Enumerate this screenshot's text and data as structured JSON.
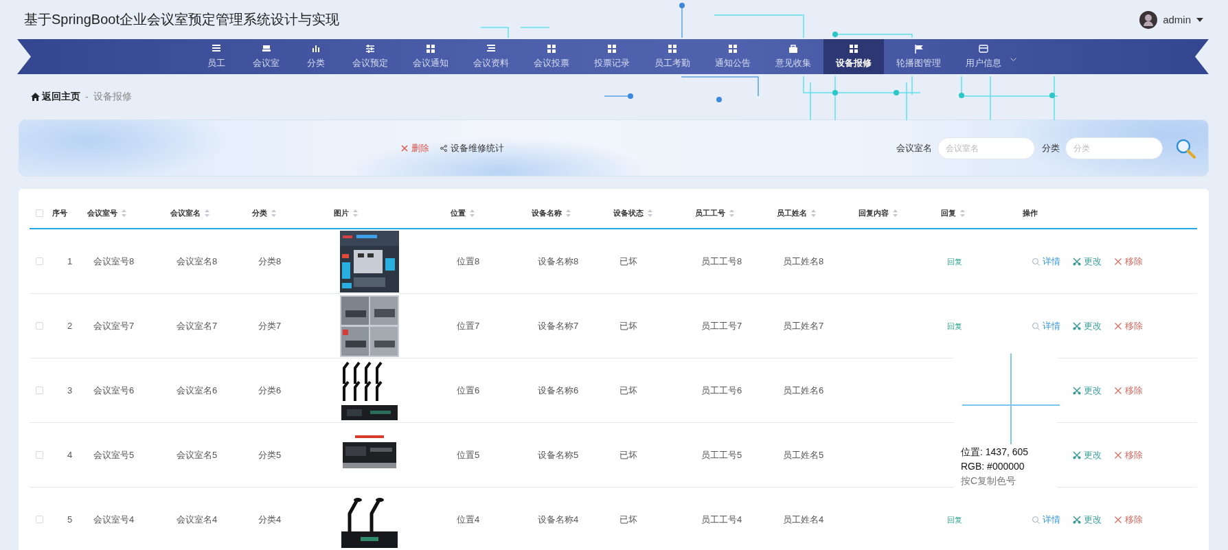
{
  "header": {
    "title": "基于SpringBoot企业会议室预定管理系统设计与实现",
    "user": "admin"
  },
  "nav": [
    {
      "label": "员工",
      "selected": false
    },
    {
      "label": "会议室",
      "selected": false
    },
    {
      "label": "分类",
      "selected": false
    },
    {
      "label": "会议预定",
      "selected": false
    },
    {
      "label": "会议通知",
      "selected": false
    },
    {
      "label": "会议资料",
      "selected": false
    },
    {
      "label": "会议投票",
      "selected": false
    },
    {
      "label": "投票记录",
      "selected": false
    },
    {
      "label": "员工考勤",
      "selected": false
    },
    {
      "label": "通知公告",
      "selected": false
    },
    {
      "label": "意见收集",
      "selected": false
    },
    {
      "label": "设备报修",
      "selected": true
    },
    {
      "label": "轮播图管理",
      "selected": false
    },
    {
      "label": "用户信息",
      "selected": false,
      "has_menu": true
    }
  ],
  "breadcrumb": {
    "home": "返回主页",
    "separator": "-",
    "current": "设备报修"
  },
  "toolbar": {
    "actions": [
      {
        "label": "删除",
        "kind": "delete"
      },
      {
        "label": "设备维修统计",
        "kind": "stats"
      }
    ],
    "filters": [
      {
        "label": "会议室名",
        "placeholder": "会议室名"
      },
      {
        "label": "分类",
        "placeholder": "分类"
      }
    ]
  },
  "table": {
    "select_all": {
      "checked": false
    },
    "columns": [
      {
        "label": "序号",
        "sortable": false
      },
      {
        "label": "会议室号",
        "sortable": true
      },
      {
        "label": "会议室名",
        "sortable": true
      },
      {
        "label": "分类",
        "sortable": true
      },
      {
        "label": "图片",
        "sortable": true
      },
      {
        "label": "位置",
        "sortable": true
      },
      {
        "label": "设备名称",
        "sortable": true
      },
      {
        "label": "设备状态",
        "sortable": true
      },
      {
        "label": "员工工号",
        "sortable": true
      },
      {
        "label": "员工姓名",
        "sortable": true
      },
      {
        "label": "回复内容",
        "sortable": true
      },
      {
        "label": "回复",
        "sortable": true
      },
      {
        "label": "操作",
        "sortable": false
      }
    ],
    "rows": [
      {
        "checked": false,
        "index": "1",
        "room_no": "会议室号8",
        "room_name": "会议室名8",
        "category": "分类8",
        "image": {
          "kind": "picture"
        },
        "location": "位置8",
        "device": "设备名称8",
        "status": "已坏",
        "emp_no": "员工工号8",
        "emp_name": "员工姓名8",
        "reply": "回复",
        "actions": [
          {
            "label": "详情",
            "kind": "detail"
          },
          {
            "label": "更改",
            "kind": "edit"
          },
          {
            "label": "移除",
            "kind": "delete"
          }
        ]
      },
      {
        "checked": false,
        "index": "2",
        "room_no": "会议室号7",
        "room_name": "会议室名7",
        "category": "分类7",
        "image": {
          "kind": "picture"
        },
        "location": "位置7",
        "device": "设备名称7",
        "status": "已坏",
        "emp_no": "员工工号7",
        "emp_name": "员工姓名7",
        "reply": "回复",
        "actions": [
          {
            "label": "详情",
            "kind": "detail"
          },
          {
            "label": "更改",
            "kind": "edit"
          },
          {
            "label": "移除",
            "kind": "delete"
          }
        ]
      },
      {
        "checked": false,
        "index": "3",
        "room_no": "会议室号6",
        "room_name": "会议室名6",
        "category": "分类6",
        "image": {
          "kind": "picture"
        },
        "location": "位置6",
        "device": "设备名称6",
        "status": "已坏",
        "emp_no": "员工工号6",
        "emp_name": "员工姓名6",
        "actions": [
          {
            "label": "更改",
            "kind": "edit"
          },
          {
            "label": "移除",
            "kind": "delete"
          }
        ]
      },
      {
        "checked": false,
        "index": "4",
        "room_no": "会议室号5",
        "room_name": "会议室名5",
        "category": "分类5",
        "image": {
          "kind": "picture"
        },
        "location": "位置5",
        "device": "设备名称5",
        "status": "已坏",
        "emp_no": "员工工号5",
        "emp_name": "员工姓名5",
        "actions": [
          {
            "label": "更改",
            "kind": "edit"
          },
          {
            "label": "移除",
            "kind": "delete"
          }
        ]
      },
      {
        "checked": false,
        "index": "5",
        "room_no": "会议室号4",
        "room_name": "会议室名4",
        "category": "分类4",
        "image": {
          "kind": "picture"
        },
        "location": "位置4",
        "device": "设备名称4",
        "status": "已坏",
        "emp_no": "员工工号4",
        "emp_name": "员工姓名4",
        "reply": "回复",
        "actions": [
          {
            "label": "详情",
            "kind": "detail"
          },
          {
            "label": "更改",
            "kind": "edit"
          },
          {
            "label": "移除",
            "kind": "delete"
          }
        ]
      }
    ]
  },
  "color_picker": {
    "position": "位置: 1437, 605",
    "rgb": "RGB: #000000",
    "hint": "按C复制色号"
  }
}
